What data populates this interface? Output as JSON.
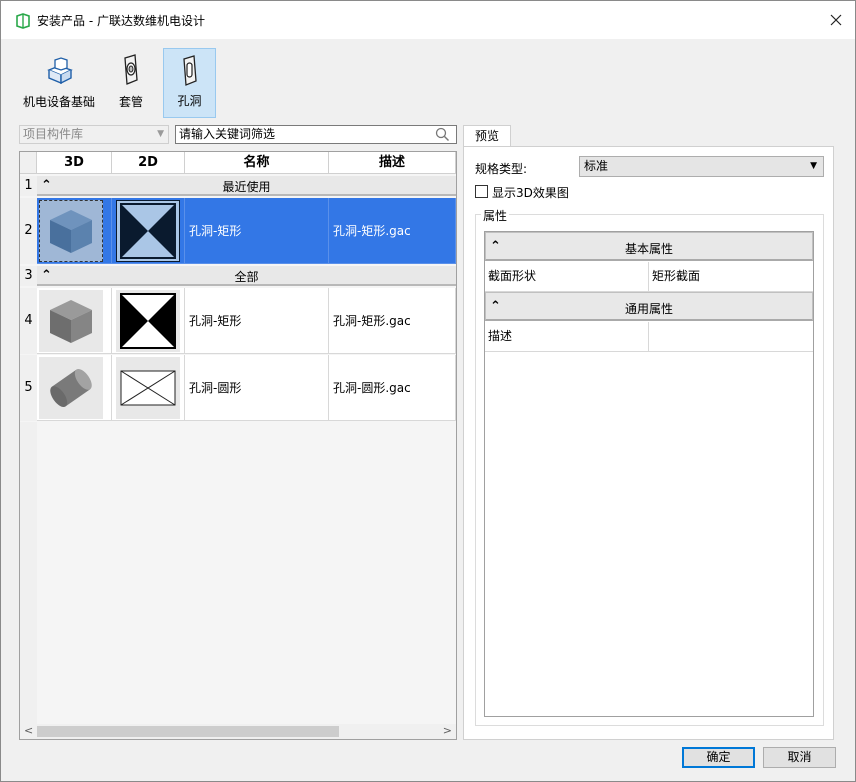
{
  "window": {
    "title": "安装产品 - 广联达数维机电设计"
  },
  "toolbar": {
    "items": [
      {
        "label": "机电设备基础",
        "icon": "equipment-base-icon",
        "active": false
      },
      {
        "label": "套管",
        "icon": "sleeve-icon",
        "active": false
      },
      {
        "label": "孔洞",
        "icon": "hole-icon",
        "active": true
      }
    ]
  },
  "library": {
    "selected": "项目构件库"
  },
  "search": {
    "placeholder": "请输入关键词筛选",
    "value": "请输入关键词筛选"
  },
  "table": {
    "columns": [
      "3D",
      "2D",
      "名称",
      "描述"
    ],
    "groups": [
      {
        "row": "1",
        "title": "最近使用"
      },
      {
        "row": "3",
        "title": "全部"
      }
    ],
    "rows": [
      {
        "row": "2",
        "name": "孔洞-矩形",
        "desc": "孔洞-矩形.gac",
        "selected": true,
        "thumb3d": "blue-cube-icon",
        "thumb2d": "rect-hole-symbol-icon"
      },
      {
        "row": "4",
        "name": "孔洞-矩形",
        "desc": "孔洞-矩形.gac",
        "selected": false,
        "thumb3d": "gray-cube-icon",
        "thumb2d": "rect-hole-symbol-icon"
      },
      {
        "row": "5",
        "name": "孔洞-圆形",
        "desc": "孔洞-圆形.gac",
        "selected": false,
        "thumb3d": "gray-cylinder-icon",
        "thumb2d": "round-hole-symbol-icon"
      }
    ]
  },
  "preview": {
    "tab": "预览",
    "spec_label": "规格类型:",
    "spec_value": "标准",
    "show3d_label": "显示3D效果图",
    "props_group_label": "属性",
    "sections": [
      {
        "title": "基本属性",
        "rows": [
          {
            "key": "截面形状",
            "value": "矩形截面"
          }
        ]
      },
      {
        "title": "通用属性",
        "rows": [
          {
            "key": "描述",
            "value": ""
          }
        ]
      }
    ]
  },
  "buttons": {
    "ok": "确定",
    "cancel": "取消"
  },
  "colors": {
    "selection": "#3377e6",
    "accent": "#0078d7"
  }
}
